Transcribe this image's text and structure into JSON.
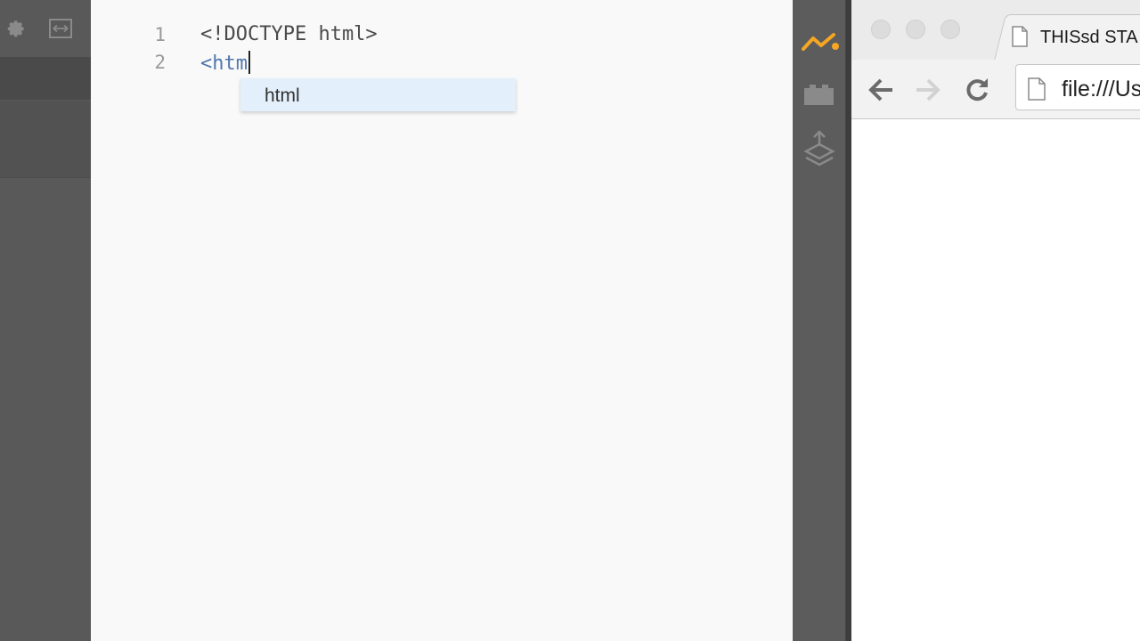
{
  "sidebar": {
    "icons": [
      "gear-icon",
      "expand-horizontal-icon"
    ]
  },
  "editor": {
    "lines": [
      {
        "number": "1",
        "text": "<!DOCTYPE html>"
      },
      {
        "number": "2",
        "text": "<htm"
      }
    ],
    "autocomplete": {
      "suggestion": "html"
    }
  },
  "toolstrip": {
    "icons": [
      "live-preview-icon",
      "extensions-icon",
      "extract-layers-icon"
    ],
    "accent_color": "#f5a623"
  },
  "browser": {
    "tab_title": "THISsd STA",
    "url": "file:///Us",
    "icons": [
      "back-arrow-icon",
      "forward-arrow-icon",
      "reload-icon",
      "page-icon"
    ]
  }
}
